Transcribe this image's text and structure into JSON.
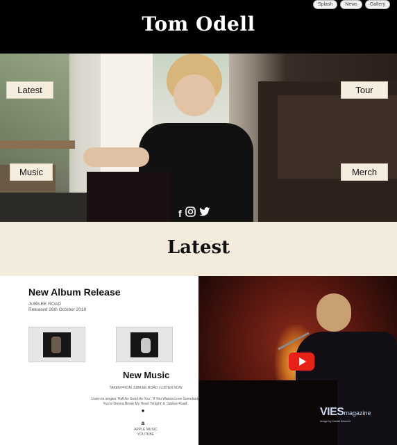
{
  "header": {
    "title": "Tom Odell",
    "nav": [
      "Splash",
      "News",
      "Gallery"
    ]
  },
  "hero": {
    "buttons": {
      "latest": "Latest",
      "tour": "Tour",
      "music": "Music",
      "merch": "Merch"
    },
    "social_icons": [
      "facebook-icon",
      "instagram-icon",
      "twitter-icon"
    ]
  },
  "latest_section": {
    "title": "Latest"
  },
  "release": {
    "heading": "New Album Release",
    "album_name": "JUBILEE ROAD",
    "release_date": "Released 26th October 2018",
    "new_music_heading": "New Music",
    "new_music_subtitle": "TAKEN FROM JUBILEE ROAD | LISTEN NOW",
    "singles_line1": "Listen to singles 'Half As Good As You', 'If You Wanna Love Somebody,",
    "singles_line2": "You're Gonna Break My Heart Tonight' & 'Jubilee Road'.",
    "services": [
      "APPLE MUSIC",
      "YOUTUBE"
    ]
  },
  "video": {
    "watermark": "VIES",
    "watermark_sub": "magazine",
    "watermark_tag": "Image by Daniel Bennett"
  },
  "colors": {
    "header_bg": "#000000",
    "band_bg": "#f3ecdc",
    "button_bg": "#f5eddd",
    "youtube_red": "#e62117"
  }
}
